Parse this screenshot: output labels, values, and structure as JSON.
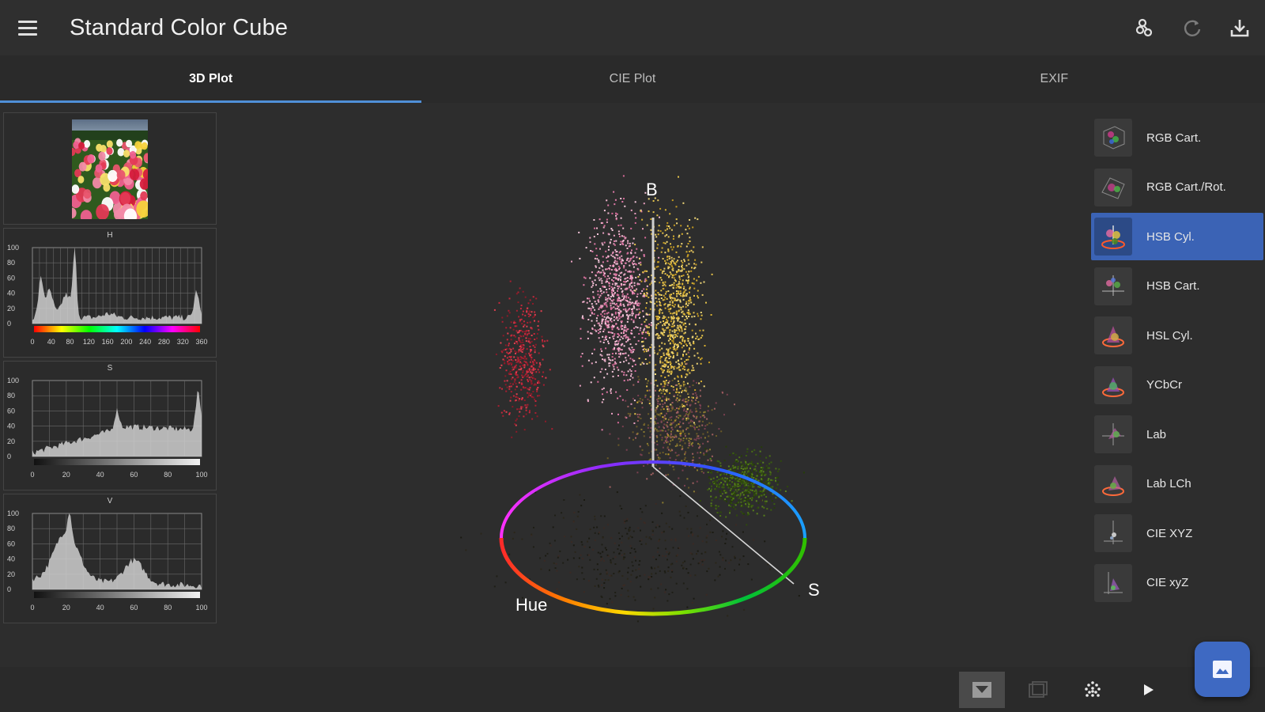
{
  "app": {
    "title": "Standard Color Cube"
  },
  "colors": {
    "accent": "#4f8fd8",
    "selected": "#3b63b5",
    "fab": "#3e69c2"
  },
  "appbar_icons": [
    "palette-icon",
    "refresh-icon",
    "download-icon"
  ],
  "tabs": [
    {
      "label": "3D Plot",
      "active": true
    },
    {
      "label": "CIE Plot",
      "active": false
    },
    {
      "label": "EXIF",
      "active": false
    }
  ],
  "histograms": {
    "h": {
      "title": "H",
      "y_ticks": [
        "100",
        "80",
        "60",
        "40",
        "20",
        "0"
      ],
      "x_ticks": [
        "0",
        "40",
        "80",
        "120",
        "160",
        "200",
        "240",
        "280",
        "320",
        "360"
      ]
    },
    "s": {
      "title": "S",
      "y_ticks": [
        "100",
        "80",
        "60",
        "40",
        "20",
        "0"
      ],
      "x_ticks": [
        "0",
        "20",
        "40",
        "60",
        "80",
        "100"
      ]
    },
    "v": {
      "title": "V",
      "y_ticks": [
        "100",
        "80",
        "60",
        "40",
        "20",
        "0"
      ],
      "x_ticks": [
        "0",
        "20",
        "40",
        "60",
        "80",
        "100"
      ]
    }
  },
  "plot": {
    "axis_b": "B",
    "axis_s": "S",
    "axis_hue": "Hue"
  },
  "color_spaces": [
    {
      "label": "RGB Cart.",
      "selected": false
    },
    {
      "label": "RGB Cart./Rot.",
      "selected": false
    },
    {
      "label": "HSB Cyl.",
      "selected": true
    },
    {
      "label": "HSB Cart.",
      "selected": false
    },
    {
      "label": "HSL Cyl.",
      "selected": false
    },
    {
      "label": "YCbCr",
      "selected": false
    },
    {
      "label": "Lab",
      "selected": false
    },
    {
      "label": "Lab LCh",
      "selected": false
    },
    {
      "label": "CIE XYZ",
      "selected": false
    },
    {
      "label": "CIE xyZ",
      "selected": false
    }
  ],
  "bottom_icons": [
    "image-view-icon",
    "layers-icon",
    "scatter-icon",
    "play-icon"
  ],
  "fab_icon": "image-picker-icon"
}
